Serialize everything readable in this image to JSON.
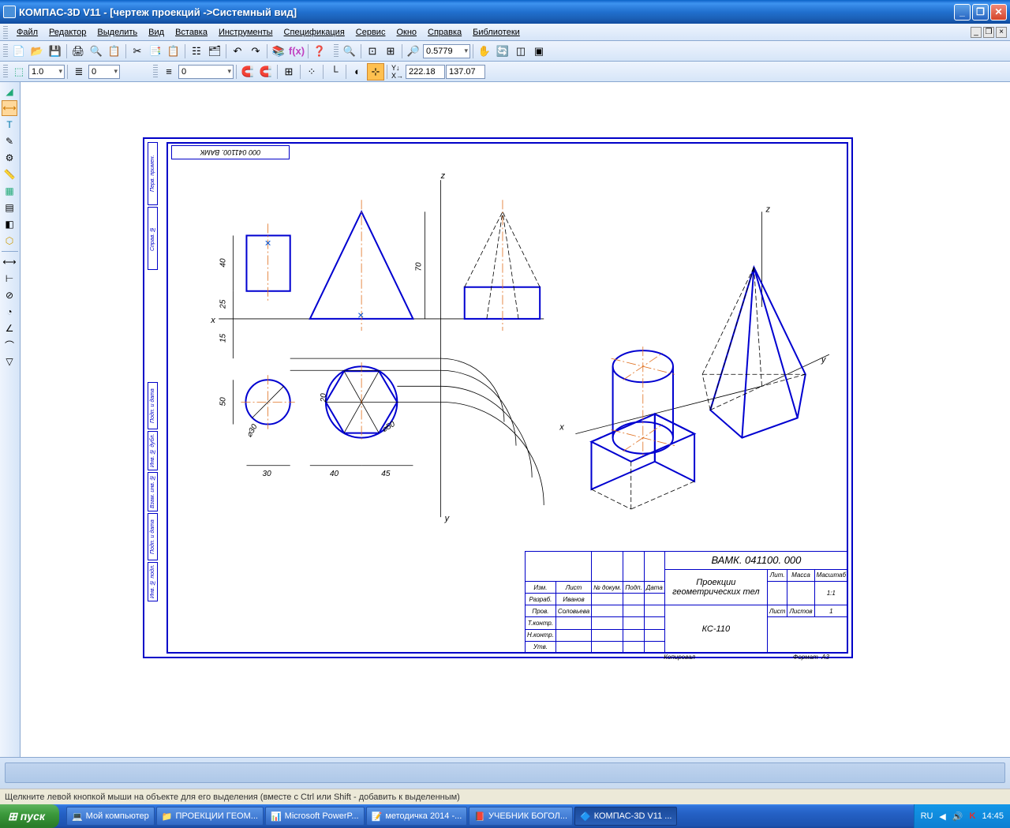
{
  "title": "КОМПАС-3D V11 - [чертеж проекций ->Системный вид]",
  "menu": {
    "file": "Файл",
    "edit": "Редактор",
    "select": "Выделить",
    "view": "Вид",
    "insert": "Вставка",
    "tools": "Инструменты",
    "spec": "Спецификация",
    "service": "Сервис",
    "window": "Окно",
    "help": "Справка",
    "libs": "Библиотеки"
  },
  "toolbar2": {
    "zoom_value": "0.5779"
  },
  "toolbar3": {
    "scale": "1.0",
    "layer": "0",
    "style": "0",
    "coord_x": "222.18",
    "coord_y": "137.07"
  },
  "drawing": {
    "top_code_rev": "000 041100. ВАМК",
    "axes": {
      "x": "x",
      "y": "y",
      "z": "z"
    },
    "dims": {
      "d40": "40",
      "d25": "25",
      "d15": "15",
      "d50": "50",
      "d30": "30",
      "d40b": "40",
      "d45": "45",
      "d70": "70",
      "d20": "20",
      "r30": "⌀30",
      "r50": "⌀50"
    },
    "titleblock": {
      "code": "ВАМК. 041100. 000",
      "name_l1": "Проекции",
      "name_l2": "геометрических тел",
      "group": "КС-110",
      "scale": "1:1",
      "sheets": "1",
      "format": "А3",
      "kopiroval": "Копировал",
      "format_lbl": "Формат",
      "h_izm": "Изм.",
      "h_list": "Лист",
      "h_ndoc": "№ докум.",
      "h_podp": "Подп.",
      "h_data": "Дата",
      "r_razrab": "Разраб.",
      "r_prov": "Пров.",
      "r_tkontr": "Т.контр.",
      "r_nkontr": "Н.контр.",
      "r_utv": "Утв.",
      "n_razrab": "Иванов",
      "n_prov": "Соловьева",
      "h_lit": "Лит.",
      "h_massa": "Масса",
      "h_masht": "Масштаб",
      "h_list2": "Лист",
      "h_listov": "Листов"
    },
    "sidelabels": {
      "perv": "Перв. примен.",
      "sprav": "Справ. №",
      "podp1": "Подп. и дата",
      "inv1": "Инв. № дубл.",
      "vzam": "Взам. инв. №",
      "podp2": "Подп. и дата",
      "inv2": "Инв. № подл."
    }
  },
  "statusbar": "Щелкните левой кнопкой мыши на объекте для его выделения (вместе с Ctrl или Shift - добавить к выделенным)",
  "taskbar": {
    "start": "пуск",
    "items": [
      "Мой компьютер",
      "ПРОЕКЦИИ ГЕОМ...",
      "Microsoft PowerP...",
      "методичка 2014 -...",
      "УЧЕБНИК БОГОЛ...",
      "КОМПАС-3D V11 ..."
    ],
    "lang": "RU",
    "time": "14:45"
  }
}
